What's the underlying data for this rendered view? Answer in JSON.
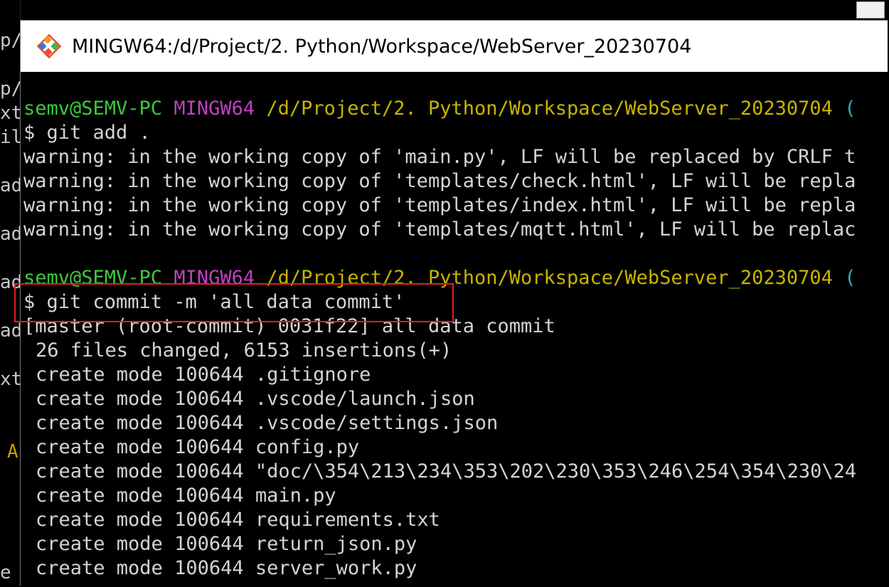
{
  "window": {
    "title": "MINGW64:/d/Project/2. Python/Workspace/WebServer_20230704"
  },
  "background_fragments": [
    "p/",
    "p/",
    "xt",
    "il",
    "ad",
    "ad",
    "ad",
    "ad",
    "xt",
    "A",
    "e"
  ],
  "prompt": {
    "user_host": "semv@SEMV-PC",
    "shell": "MINGW64",
    "path": "/d/Project/2. Python/Workspace/WebServer_20230704",
    "branch_open": "("
  },
  "lines": {
    "cmd_add": "$ git add .",
    "warn1": "warning: in the working copy of 'main.py', LF will be replaced by CRLF t",
    "warn2": "warning: in the working copy of 'templates/check.html', LF will be repla",
    "warn3": "warning: in the working copy of 'templates/index.html', LF will be repla",
    "warn4": "warning: in the working copy of 'templates/mqtt.html', LF will be replac",
    "cmd_commit": "$ git commit -m 'all data commit'",
    "commit_result": "[master (root-commit) 0031f22] all data commit",
    "stats": "26 files changed, 6153 insertions(+)",
    "files": [
      "create mode 100644 .gitignore",
      "create mode 100644 .vscode/launch.json",
      "create mode 100644 .vscode/settings.json",
      "create mode 100644 config.py",
      "create mode 100644 \"doc/\\354\\213\\234\\353\\202\\230\\353\\246\\254\\354\\230\\24",
      "create mode 100644 main.py",
      "create mode 100644 requirements.txt",
      "create mode 100644 return_json.py",
      "create mode 100644 server_work.py"
    ]
  },
  "colors": {
    "prompt_user": "#3ec83e",
    "prompt_shell": "#c040c0",
    "prompt_path": "#c8b400",
    "highlight": "#e02020"
  },
  "icons": {
    "app": "git-diamond-icon"
  }
}
